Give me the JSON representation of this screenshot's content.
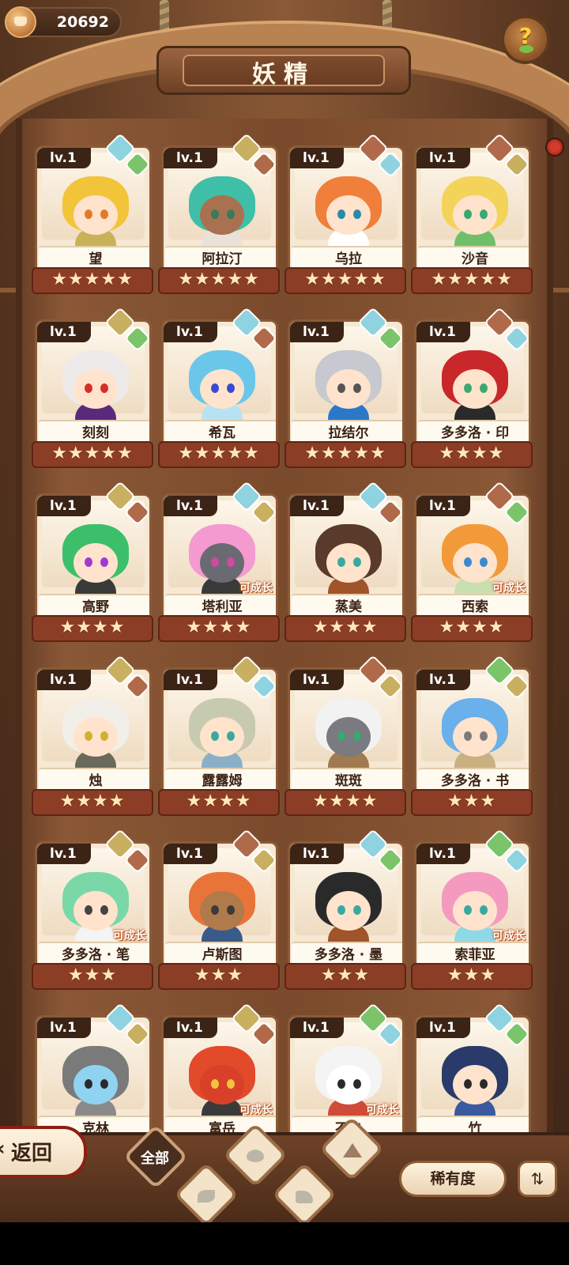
{
  "currency": {
    "value": "20692",
    "icon": "crown-coin-icon"
  },
  "help": {
    "label": "?",
    "icon": "help-sprout-icon"
  },
  "title": "妖精",
  "cards": [
    {
      "lv": "lv.1",
      "name": "望",
      "stars": "★★★★★",
      "hair": "#f2c43a",
      "skin": "#ffe3cc",
      "eye": "#e07a2a",
      "body": "#c7b25a",
      "b1": "#8fd3e0",
      "b2": "#7cc46a",
      "grow": ""
    },
    {
      "lv": "lv.1",
      "name": "阿拉汀",
      "stars": "★★★★★",
      "hair": "#3fbfa8",
      "skin": "#a9714f",
      "eye": "#3a7a5a",
      "body": "#e9e2d8",
      "b1": "#c8b060",
      "b2": "#b06a4a",
      "grow": ""
    },
    {
      "lv": "lv.1",
      "name": "乌拉",
      "stars": "★★★★★",
      "hair": "#ef7f3a",
      "skin": "#ffe3cc",
      "eye": "#2a8aa8",
      "body": "#ffffff",
      "b1": "#b06a4a",
      "b2": "#8fd3e0",
      "grow": ""
    },
    {
      "lv": "lv.1",
      "name": "沙音",
      "stars": "★★★★★",
      "hair": "#f4d35a",
      "skin": "#ffe3cc",
      "eye": "#3aa870",
      "body": "#6fbf6a",
      "b1": "#b06a4a",
      "b2": "#c8b060",
      "grow": ""
    },
    {
      "lv": "lv.1",
      "name": "刻刻",
      "stars": "★★★★★",
      "hair": "#eeeaea",
      "skin": "#ffe3cc",
      "eye": "#d4302a",
      "body": "#5a2a7a",
      "b1": "#c8b060",
      "b2": "#7cc46a",
      "grow": ""
    },
    {
      "lv": "lv.1",
      "name": "希瓦",
      "stars": "★★★★★",
      "hair": "#6ac7ea",
      "skin": "#ffe3cc",
      "eye": "#3a4ad0",
      "body": "#b7e2f4",
      "b1": "#8fd3e0",
      "b2": "#b06a4a",
      "grow": ""
    },
    {
      "lv": "lv.1",
      "name": "拉结尔",
      "stars": "★★★★★",
      "hair": "#c8c8d0",
      "skin": "#ffe3cc",
      "eye": "#555555",
      "body": "#2a78c8",
      "b1": "#8fd3e0",
      "b2": "#7cc46a",
      "grow": ""
    },
    {
      "lv": "lv.1",
      "name": "多多洛 · 印",
      "stars": "★★★★",
      "hair": "#c8282a",
      "skin": "#ffe3cc",
      "eye": "#3aa870",
      "body": "#2a2a2a",
      "b1": "#b06a4a",
      "b2": "#8fd3e0",
      "grow": ""
    },
    {
      "lv": "lv.1",
      "name": "高野",
      "stars": "★★★★",
      "hair": "#3cbf6a",
      "skin": "#ffe3cc",
      "eye": "#a03ad0",
      "body": "#3a3a3a",
      "b1": "#c8b060",
      "b2": "#b06a4a",
      "grow": ""
    },
    {
      "lv": "lv.1",
      "name": "塔利亚",
      "stars": "★★★★",
      "hair": "#f49ad0",
      "skin": "#6a6a72",
      "eye": "#d04aa0",
      "body": "#3a3a3a",
      "b1": "#8fd3e0",
      "b2": "#c8b060",
      "grow": "可成长"
    },
    {
      "lv": "lv.1",
      "name": "蒸美",
      "stars": "★★★★",
      "hair": "#5a3a2a",
      "skin": "#ffe3cc",
      "eye": "#3aa8a0",
      "body": "#a0542a",
      "b1": "#8fd3e0",
      "b2": "#b06a4a",
      "grow": ""
    },
    {
      "lv": "lv.1",
      "name": "西索",
      "stars": "★★★★",
      "hair": "#f29a3a",
      "skin": "#ffe3cc",
      "eye": "#3a8ad0",
      "body": "#c8e0b0",
      "b1": "#b06a4a",
      "b2": "#7cc46a",
      "grow": "可成长"
    },
    {
      "lv": "lv.1",
      "name": "烛",
      "stars": "★★★★",
      "hair": "#f2efe8",
      "skin": "#ffe3cc",
      "eye": "#d0b030",
      "body": "#6a6a5a",
      "b1": "#c8b060",
      "b2": "#b06a4a",
      "grow": ""
    },
    {
      "lv": "lv.1",
      "name": "露露姆",
      "stars": "★★★★",
      "hair": "#c8cab0",
      "skin": "#ffe3cc",
      "eye": "#3aa8a0",
      "body": "#8ab0c8",
      "b1": "#c8b060",
      "b2": "#8fd3e0",
      "grow": ""
    },
    {
      "lv": "lv.1",
      "name": "斑斑",
      "stars": "★★★★",
      "hair": "#f2f2f2",
      "skin": "#7a7a80",
      "eye": "#3aa870",
      "body": "#a07a50",
      "b1": "#b06a4a",
      "b2": "#c8b060",
      "grow": ""
    },
    {
      "lv": "lv.1",
      "name": "多多洛 · 书",
      "stars": "★★★",
      "hair": "#6ab0ea",
      "skin": "#ffe3cc",
      "eye": "#7a7a7a",
      "body": "#c8b080",
      "b1": "#7cc46a",
      "b2": "#c8b060",
      "grow": ""
    },
    {
      "lv": "lv.1",
      "name": "多多洛 · 笔",
      "stars": "★★★",
      "hair": "#7ad8a8",
      "skin": "#ffe3cc",
      "eye": "#444444",
      "body": "#f4f4f4",
      "b1": "#c8b060",
      "b2": "#b06a4a",
      "grow": "可成长"
    },
    {
      "lv": "lv.1",
      "name": "卢斯图",
      "stars": "★★★",
      "hair": "#e8743a",
      "skin": "#b07a4a",
      "eye": "#3a3a3a",
      "body": "#3a5a8a",
      "b1": "#b06a4a",
      "b2": "#c8b060",
      "grow": ""
    },
    {
      "lv": "lv.1",
      "name": "多多洛 · 墨",
      "stars": "★★★",
      "hair": "#2a2a2a",
      "skin": "#ffe3cc",
      "eye": "#3aa8a0",
      "body": "#a0542a",
      "b1": "#8fd3e0",
      "b2": "#7cc46a",
      "grow": ""
    },
    {
      "lv": "lv.1",
      "name": "索菲亚",
      "stars": "★★★",
      "hair": "#f49ac0",
      "skin": "#ffe3cc",
      "eye": "#3aa8a0",
      "body": "#8fd8e8",
      "b1": "#7cc46a",
      "b2": "#8fd3e0",
      "grow": "可成长"
    },
    {
      "lv": "lv.1",
      "name": "克林",
      "stars": "",
      "hair": "#7a7a7a",
      "skin": "#8fd3f0",
      "eye": "#2a2a2a",
      "body": "#8a8a8a",
      "b1": "#8fd3e0",
      "b2": "#c8b060",
      "grow": ""
    },
    {
      "lv": "lv.1",
      "name": "富岳",
      "stars": "",
      "hair": "#e24a2a",
      "skin": "#d8402a",
      "eye": "#f2c43a",
      "body": "#3a3a3a",
      "b1": "#c8b060",
      "b2": "#b06a4a",
      "grow": "可成长"
    },
    {
      "lv": "lv.1",
      "name": "不二",
      "stars": "",
      "hair": "#f4f4f4",
      "skin": "#ffffff",
      "eye": "#2a2a2a",
      "body": "#d04a3a",
      "b1": "#7cc46a",
      "b2": "#8fd3e0",
      "grow": "可成长"
    },
    {
      "lv": "lv.1",
      "name": "竹",
      "stars": "",
      "hair": "#2a3a6a",
      "skin": "#ffe3cc",
      "eye": "#2a2a2a",
      "body": "#3a5aa0",
      "b1": "#8fd3e0",
      "b2": "#7cc46a",
      "grow": ""
    }
  ],
  "bottom": {
    "back_label": "返回",
    "filter_all": "全部",
    "filters": [
      "water-drop-icon",
      "sprout-icon",
      "earth-icon",
      "mountain-icon"
    ],
    "rarity_label": "稀有度",
    "sort_icon": "sort-icon"
  }
}
